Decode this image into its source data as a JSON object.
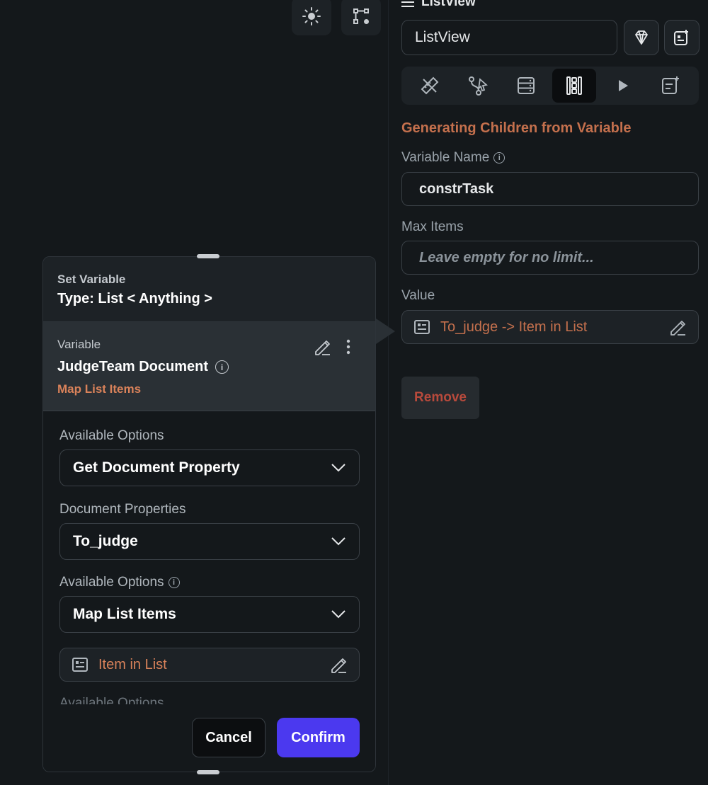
{
  "canvas": {
    "toolbar": [
      {
        "icon": "sun-icon"
      },
      {
        "icon": "node-settings-icon"
      }
    ]
  },
  "panel": {
    "header_title": "ListView",
    "widget_name_value": "ListView",
    "tabs": [
      {
        "icon": "ruler-pencil-icon",
        "active": false
      },
      {
        "icon": "action-flow-icon",
        "active": false
      },
      {
        "icon": "backend-query-icon",
        "active": false
      },
      {
        "icon": "generate-children-icon",
        "active": true
      },
      {
        "icon": "play-icon",
        "active": false
      },
      {
        "icon": "document-add-icon",
        "active": false
      }
    ],
    "section_title": "Generating Children from Variable",
    "variable_name_label": "Variable Name",
    "variable_name_value": "constrTask",
    "max_items_label": "Max Items",
    "max_items_placeholder": "Leave empty for no limit...",
    "value_label": "Value",
    "value_text": "To_judge -> Item in List",
    "remove_label": "Remove",
    "accent_color": "#c4704d"
  },
  "dialog": {
    "title_small": "Set Variable",
    "title_type": "Type: List < Anything >",
    "variable_label": "Variable",
    "variable_name": "JudgeTeam Document",
    "variable_link": "Map List Items",
    "option1_label": "Available Options",
    "option1_value": "Get Document Property",
    "doc_props_label": "Document Properties",
    "doc_props_value": "To_judge",
    "option2_label": "Available Options",
    "option2_value": "Map List Items",
    "item_field_text": "Item in List",
    "option3_label": "Available Options",
    "cancel_label": "Cancel",
    "confirm_label": "Confirm",
    "confirm_color": "#4b39ef"
  }
}
